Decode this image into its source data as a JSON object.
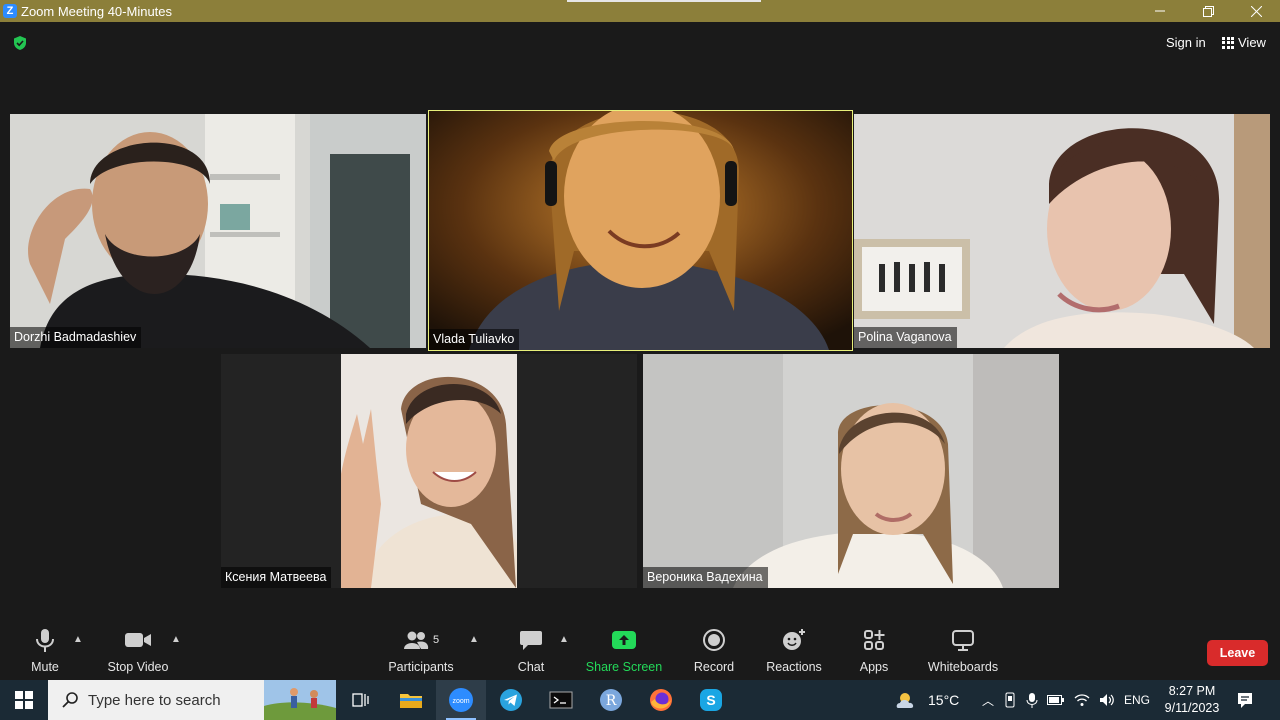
{
  "window": {
    "title": "Zoom Meeting 40-Minutes",
    "controls": [
      "minimize",
      "restore",
      "close"
    ]
  },
  "header": {
    "sign_in_label": "Sign in",
    "view_label": "View"
  },
  "participants": [
    {
      "name": "Dorzhi Badmadashiev",
      "active_speaker": false
    },
    {
      "name": "Vlada Tuliavko",
      "active_speaker": true
    },
    {
      "name": "Polina Vaganova",
      "active_speaker": false
    },
    {
      "name": "Ксения Матвеева",
      "active_speaker": false
    },
    {
      "name": "Вероника Вадехина",
      "active_speaker": false
    }
  ],
  "toolbar": {
    "mute_label": "Mute",
    "stop_video_label": "Stop Video",
    "participants_label": "Participants",
    "participants_count": "5",
    "chat_label": "Chat",
    "share_screen_label": "Share Screen",
    "record_label": "Record",
    "reactions_label": "Reactions",
    "apps_label": "Apps",
    "whiteboards_label": "Whiteboards",
    "leave_label": "Leave"
  },
  "taskbar": {
    "search_placeholder": "Type here to search",
    "apps": [
      "task-view",
      "file-explorer",
      "zoom",
      "telegram",
      "terminal",
      "r",
      "firefox",
      "skype"
    ],
    "weather": "15°C",
    "language": "ENG",
    "time": "8:27 PM",
    "date": "9/11/2023"
  },
  "colors": {
    "titlebar": "#8c7f3a",
    "active_speaker_border": "#e8f07a",
    "share_screen": "#23d959",
    "leave": "#d92b2b",
    "taskbar": "#1b2a35"
  }
}
